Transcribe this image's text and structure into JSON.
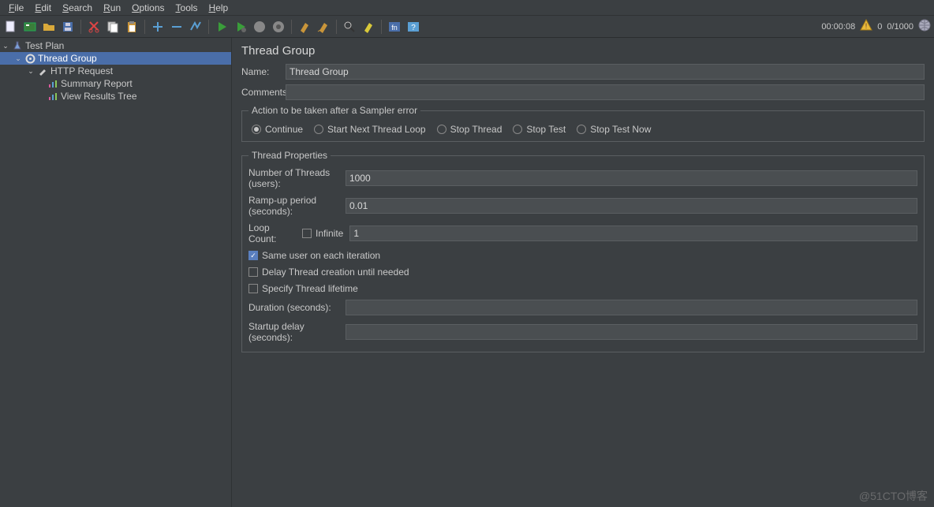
{
  "menus": [
    "File",
    "Edit",
    "Search",
    "Run",
    "Options",
    "Tools",
    "Help"
  ],
  "status": {
    "time": "00:00:08",
    "active": "0",
    "total": "0/1000"
  },
  "tree": {
    "plan": "Test Plan",
    "group": "Thread Group",
    "request": "HTTP Request",
    "summary": "Summary Report",
    "results": "View Results Tree"
  },
  "panel": {
    "title": "Thread Group",
    "name_label": "Name:",
    "name_value": "Thread Group",
    "comments_label": "Comments:",
    "comments_value": "",
    "error_legend": "Action to be taken after a Sampler error",
    "radios": {
      "continue": "Continue",
      "next": "Start Next Thread Loop",
      "stop_thread": "Stop Thread",
      "stop_test": "Stop Test",
      "stop_now": "Stop Test Now"
    },
    "props_legend": "Thread Properties",
    "threads_label": "Number of Threads (users):",
    "threads_value": "1000",
    "ramp_label": "Ramp-up period (seconds):",
    "ramp_value": "0.01",
    "loop_label": "Loop Count:",
    "infinite_label": "Infinite",
    "loop_value": "1",
    "same_user": "Same user on each iteration",
    "delay_creation": "Delay Thread creation until needed",
    "specify_lifetime": "Specify Thread lifetime",
    "duration_label": "Duration (seconds):",
    "startup_label": "Startup delay (seconds):"
  },
  "watermark": "@51CTO博客"
}
